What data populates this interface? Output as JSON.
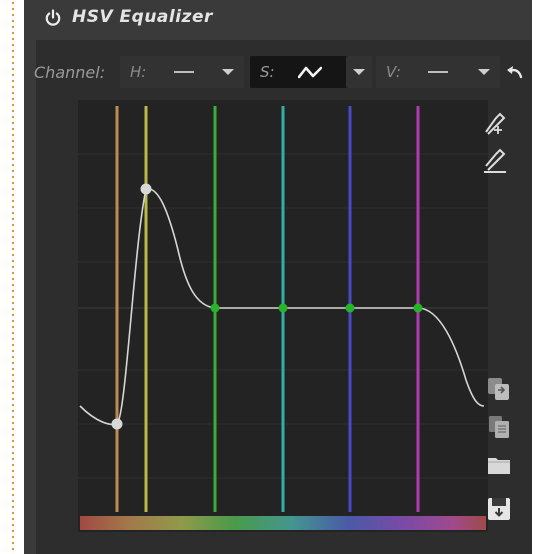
{
  "module": {
    "title": "HSV Equalizer"
  },
  "channel": {
    "label": "Channel:",
    "h": {
      "label": "H:",
      "mode": "line"
    },
    "s": {
      "label": "S:",
      "mode": "curve",
      "active": true
    },
    "v": {
      "label": "V:",
      "mode": "line"
    }
  },
  "icons": {
    "power": "power-icon",
    "undo": "undo-icon",
    "pick": "color-picker-icon",
    "pick_area": "color-picker-area-icon",
    "copy": "copy-icon",
    "paste": "paste-icon",
    "open": "folder-icon",
    "save": "save-icon"
  },
  "colors": {
    "bands": [
      "#c08a55",
      "#b8ba4a",
      "#3aae3a",
      "#32b0a6",
      "#4a4ac4",
      "#b03ab0"
    ],
    "control_point": "#28b428",
    "curve": "#d6d6d6"
  }
}
